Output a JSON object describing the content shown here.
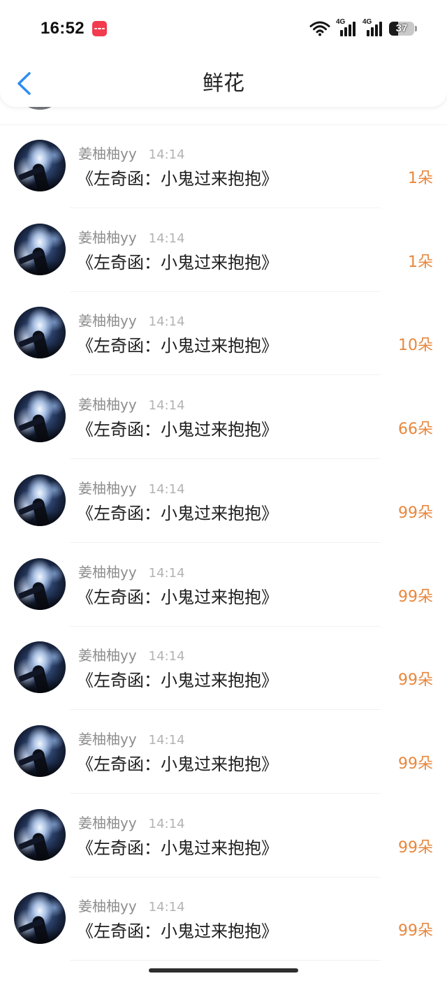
{
  "status_bar": {
    "time": "16:52",
    "app_icon": "red-app-notification-icon",
    "wifi_icon": "wifi-icon",
    "signals": [
      {
        "label": "4G",
        "bars": 4
      },
      {
        "label": "4G",
        "bars": 4
      }
    ],
    "battery_level": "37"
  },
  "header": {
    "back_icon": "chevron-left-icon",
    "title": "鲜花"
  },
  "colors": {
    "accent": "#2d8cf0",
    "count": "#e8873d",
    "name": "#8e8e8e",
    "time": "#b3b3b3",
    "title": "#1d1d1d",
    "app_icon": "#f23b4e"
  },
  "list": {
    "items": [
      {
        "name": "姜柚柚yy",
        "time": "14:14",
        "title": "《左奇函：小鬼过来抱抱》",
        "count": "1朵"
      },
      {
        "name": "姜柚柚yy",
        "time": "14:14",
        "title": "《左奇函：小鬼过来抱抱》",
        "count": "1朵"
      },
      {
        "name": "姜柚柚yy",
        "time": "14:14",
        "title": "《左奇函：小鬼过来抱抱》",
        "count": "10朵"
      },
      {
        "name": "姜柚柚yy",
        "time": "14:14",
        "title": "《左奇函：小鬼过来抱抱》",
        "count": "66朵"
      },
      {
        "name": "姜柚柚yy",
        "time": "14:14",
        "title": "《左奇函：小鬼过来抱抱》",
        "count": "99朵"
      },
      {
        "name": "姜柚柚yy",
        "time": "14:14",
        "title": "《左奇函：小鬼过来抱抱》",
        "count": "99朵"
      },
      {
        "name": "姜柚柚yy",
        "time": "14:14",
        "title": "《左奇函：小鬼过来抱抱》",
        "count": "99朵"
      },
      {
        "name": "姜柚柚yy",
        "time": "14:14",
        "title": "《左奇函：小鬼过来抱抱》",
        "count": "99朵"
      },
      {
        "name": "姜柚柚yy",
        "time": "14:14",
        "title": "《左奇函：小鬼过来抱抱》",
        "count": "99朵"
      },
      {
        "name": "姜柚柚yy",
        "time": "14:14",
        "title": "《左奇函：小鬼过来抱抱》",
        "count": "99朵"
      }
    ]
  }
}
